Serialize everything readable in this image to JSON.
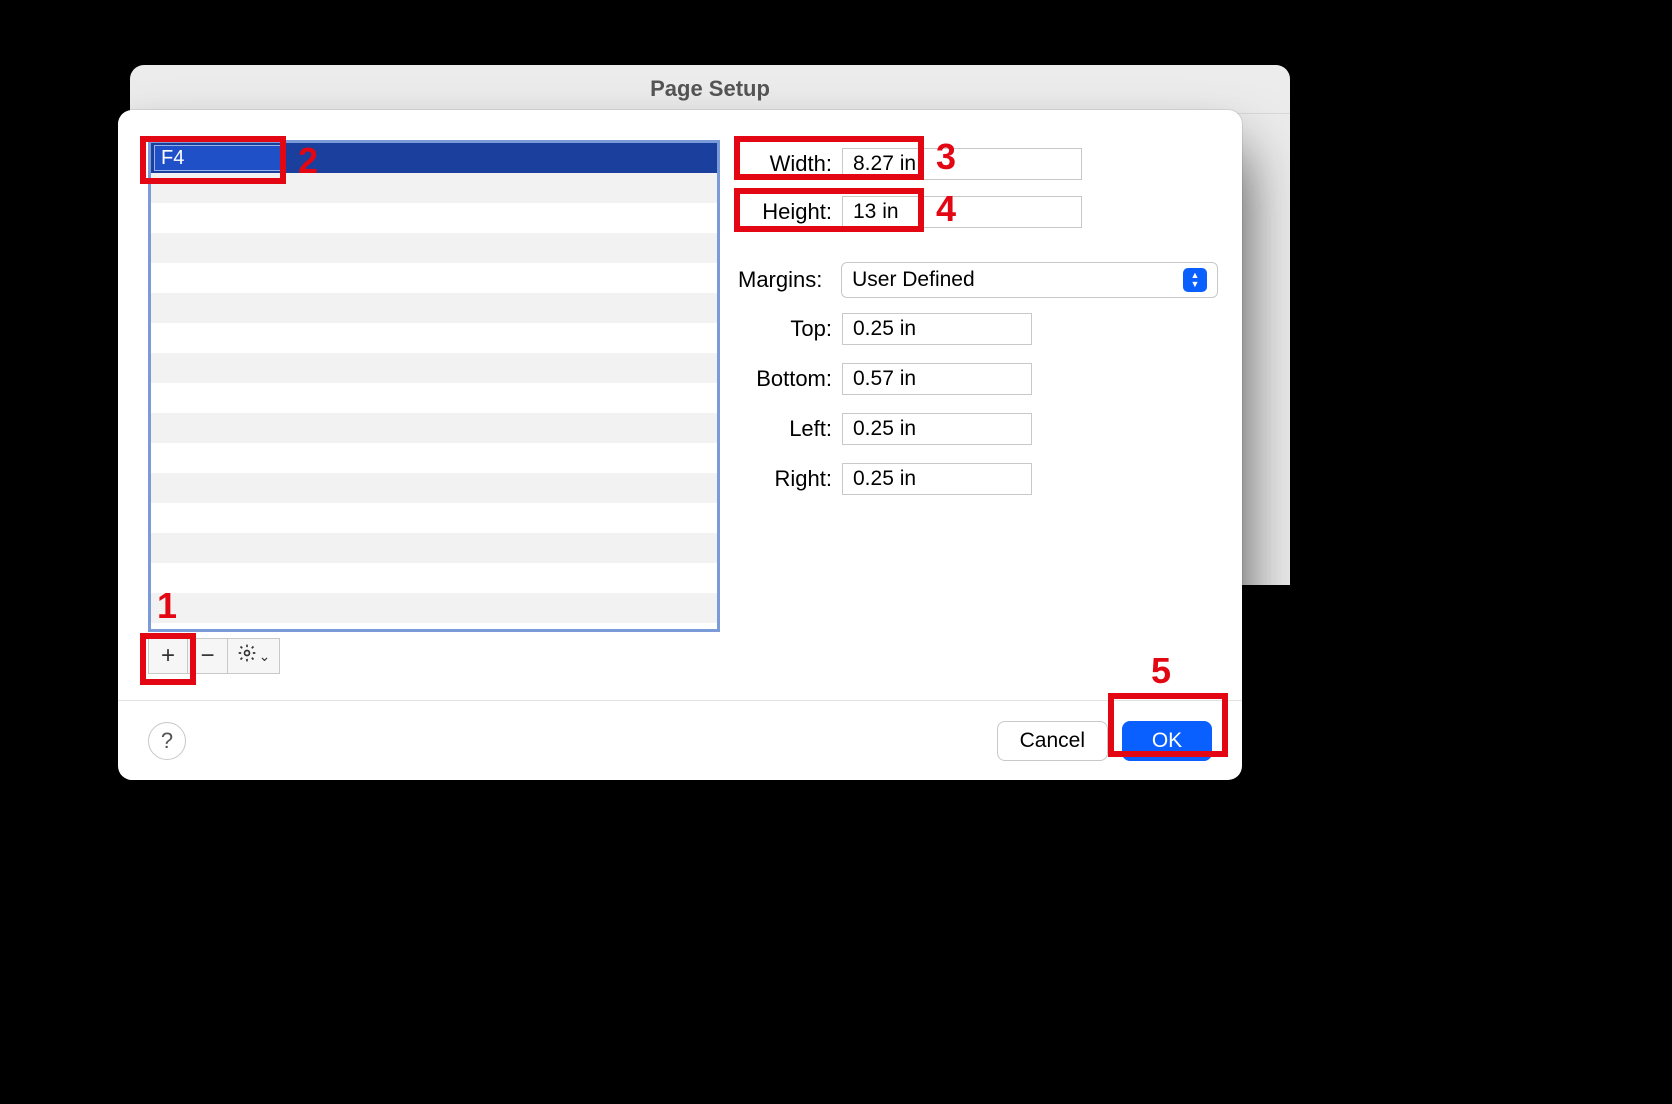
{
  "window": {
    "title": "Page Setup"
  },
  "papers": {
    "selected_name": "F4"
  },
  "size": {
    "width_label": "Width:",
    "width_value": "8.27 in",
    "height_label": "Height:",
    "height_value": "13 in"
  },
  "margins": {
    "label": "Margins:",
    "preset": "User Defined",
    "top_label": "Top:",
    "top_value": "0.25 in",
    "bottom_label": "Bottom:",
    "bottom_value": "0.57 in",
    "left_label": "Left:",
    "left_value": "0.25 in",
    "right_label": "Right:",
    "right_value": "0.25 in"
  },
  "toolbar": {
    "add_glyph": "+",
    "remove_glyph": "−"
  },
  "footer": {
    "help_glyph": "?",
    "cancel_label": "Cancel",
    "ok_label": "OK"
  },
  "annotations": {
    "n1": "1",
    "n2": "2",
    "n3": "3",
    "n4": "4",
    "n5": "5"
  }
}
